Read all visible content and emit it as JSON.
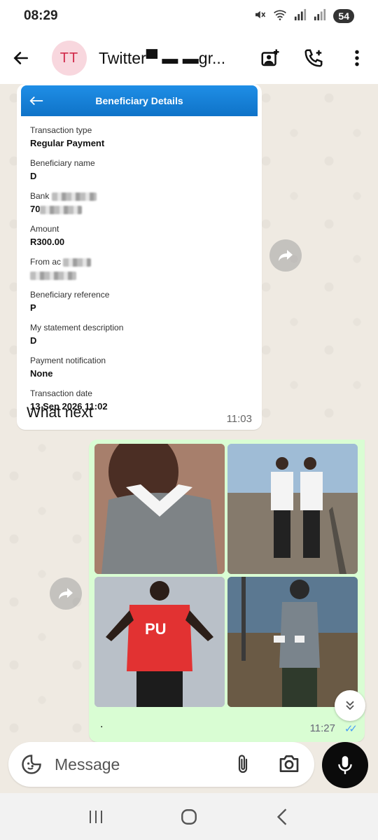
{
  "status": {
    "time": "08:29",
    "battery": "54",
    "icons": [
      "mute-icon",
      "wifi-icon",
      "signal-icon",
      "signal-icon-2"
    ]
  },
  "header": {
    "avatar_initials": "TT",
    "contact_name": "Twitter▀  ▬ ▬gr...",
    "actions": [
      "add-media-icon",
      "add-call-icon",
      "more-icon"
    ]
  },
  "incoming": {
    "receipt": {
      "title": "Beneficiary Details",
      "fields": [
        {
          "label": "Transaction type",
          "value": "Regular Payment"
        },
        {
          "label": "Beneficiary name",
          "value": "D"
        },
        {
          "label": "Bank",
          "value": "70"
        },
        {
          "label": "Amount",
          "value": "R300.00"
        },
        {
          "label": "From ac",
          "value": ""
        },
        {
          "label": "Beneficiary reference",
          "value": "P"
        },
        {
          "label": "My statement description",
          "value": "D"
        },
        {
          "label": "Payment notification",
          "value": "None"
        },
        {
          "label": "Transaction date",
          "value": "13 Sep 2026 11:02"
        }
      ]
    },
    "caption": "What next",
    "time": "11:03"
  },
  "outgoing": {
    "caption": ".",
    "time": "11:27",
    "status": "read",
    "ticks": "✓✓",
    "photo_logo_text": "PU"
  },
  "composer": {
    "placeholder": "Message"
  },
  "colors": {
    "accent_blue": "#1f8ee6",
    "outgoing_bubble": "#d9fdd3",
    "chat_bg": "#efeae2",
    "read_ticks": "#4a9ff5",
    "avatar_bg": "#f8d7de",
    "avatar_text": "#d12a4b"
  }
}
